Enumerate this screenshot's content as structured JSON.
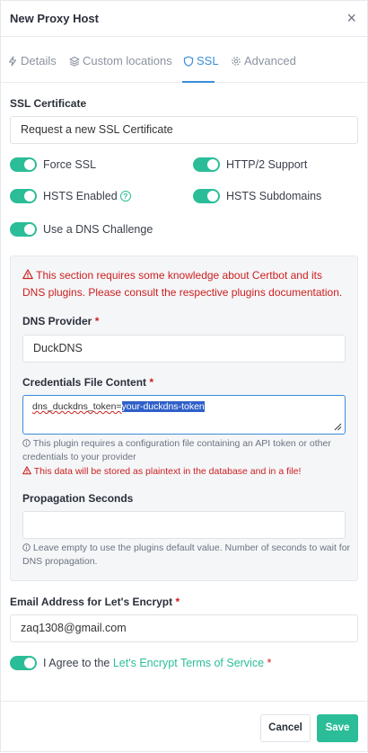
{
  "modal": {
    "title": "New Proxy Host",
    "close_glyph": "×"
  },
  "tabs": [
    {
      "label": "Details",
      "icon": "bolt-icon"
    },
    {
      "label": "Custom locations",
      "icon": "layers-icon"
    },
    {
      "label": "SSL",
      "icon": "shield-icon",
      "active": true
    },
    {
      "label": "Advanced",
      "icon": "gear-icon"
    }
  ],
  "ssl": {
    "certificate_label": "SSL Certificate",
    "certificate_value": "Request a new SSL Certificate",
    "toggles": {
      "force_ssl": {
        "label": "Force SSL",
        "on": true
      },
      "http2": {
        "label": "HTTP/2 Support",
        "on": true
      },
      "hsts_enabled": {
        "label": "HSTS Enabled",
        "on": true,
        "help": "?"
      },
      "hsts_subdomains": {
        "label": "HSTS Subdomains",
        "on": true
      },
      "dns_challenge": {
        "label": "Use a DNS Challenge",
        "on": true
      }
    }
  },
  "dns": {
    "warning": "This section requires some knowledge about Certbot and its DNS plugins. Please consult the respective plugins documentation.",
    "provider_label": "DNS Provider",
    "provider_value": "DuckDNS",
    "credentials_label": "Credentials File Content",
    "credentials_prefix": "dns_duckdns_token=",
    "credentials_selected": "your-duckdns-token",
    "credentials_hint": "This plugin requires a configuration file containing an API token or other credentials to your provider",
    "credentials_warning": "This data will be stored as plaintext in the database and in a file!",
    "propagation_label": "Propagation Seconds",
    "propagation_value": "",
    "propagation_hint": "Leave empty to use the plugins default value. Number of seconds to wait for DNS propagation."
  },
  "email": {
    "label": "Email Address for Let's Encrypt",
    "value": "zaq1308@gmail.com"
  },
  "agree": {
    "prefix": "I Agree to the ",
    "link": "Let's Encrypt Terms of Service",
    "on": true
  },
  "required_mark": "*",
  "footer": {
    "cancel_label": "Cancel",
    "save_label": "Save"
  },
  "colors": {
    "accent": "#2bbd98",
    "tab_active": "#3a8ed8",
    "danger": "#cc1f1f"
  }
}
